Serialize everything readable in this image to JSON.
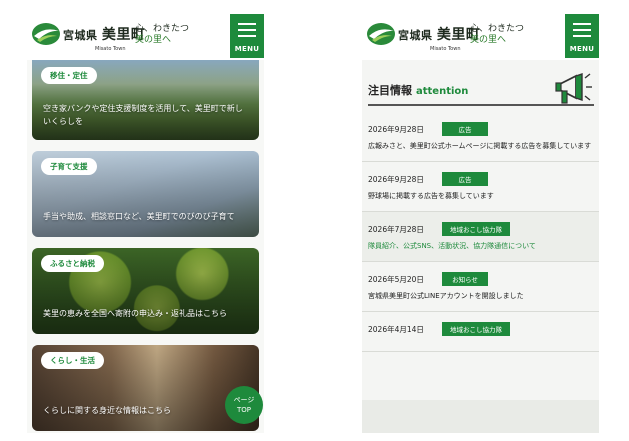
{
  "site": {
    "logo_main_prefix": "宮城県",
    "logo_main_name": "美里町",
    "logo_sub": "Misato Town",
    "tagline_line1": "心、わきたつ",
    "tagline_line2": "美の里へ",
    "menu_label": "MENU"
  },
  "left": {
    "cards": [
      {
        "tag": "移住・定住",
        "text": "空き家バンクや定住支援制度を活用して、美里町で新しいくらしを"
      },
      {
        "tag": "子育て支援",
        "text": "手当や助成、相談窓口など、美里町でのびのび子育て"
      },
      {
        "tag": "ふるさと納税",
        "text": "美里の恵みを全国へ寄附の申込み・返礼品はこちら"
      },
      {
        "tag": "くらし・生活",
        "text": "くらしに関する身近な情報はこちら"
      }
    ],
    "pagetop_line1": "ページ",
    "pagetop_line2": "TOP"
  },
  "right": {
    "attention_title": "注目情報",
    "attention_en": "attention",
    "news": [
      {
        "date": "2026年9月28日",
        "badge": "広告",
        "text": "広報みさと、美里町公式ホームページに掲載する広告を募集しています"
      },
      {
        "date": "2026年9月28日",
        "badge": "広告",
        "text": "野球場に掲載する広告を募集しています"
      },
      {
        "date": "2026年7月28日",
        "badge": "地域おこし協力隊",
        "text": "隊員紹介、公式SNS、活動状況、協力隊通信について"
      },
      {
        "date": "2026年5月20日",
        "badge": "お知らせ",
        "text": "宮城県美里町公式LINEアカウントを開設しました"
      },
      {
        "date": "2026年4月14日",
        "badge": "地域おこし協力隊",
        "text": ""
      }
    ]
  },
  "colors": {
    "brand_green": "#1e8a3c",
    "text_dark": "#222222"
  },
  "icons": [
    "town-logo-icon",
    "menu-icon",
    "megaphone-icon"
  ]
}
